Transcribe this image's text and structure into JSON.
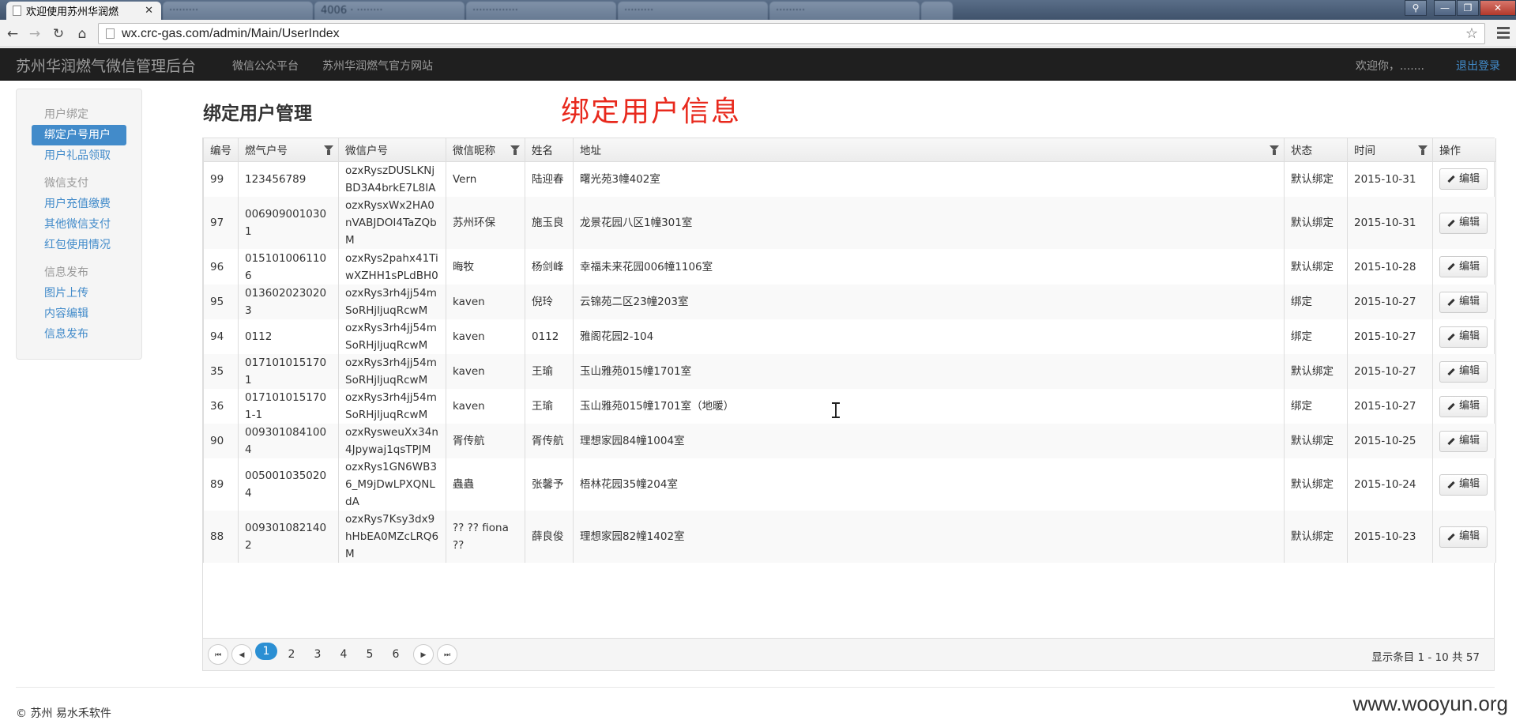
{
  "browser": {
    "active_tab_title": "欢迎使用苏州华润燃",
    "inactive_tabs": [
      "·········",
      "4006 · ········",
      "··············",
      "·········",
      "·········"
    ],
    "url": "wx.crc-gas.com/admin/Main/UserIndex"
  },
  "navbar": {
    "brand": "苏州华润燃气微信管理后台",
    "links": [
      "微信公众平台",
      "苏州华润燃气官方网站"
    ],
    "welcome": "欢迎你，.......",
    "logout": "退出登录"
  },
  "sidebar": {
    "groups": [
      {
        "header": "用户绑定",
        "items": [
          "绑定户号用户",
          "用户礼品领取"
        ]
      },
      {
        "header": "微信支付",
        "items": [
          "用户充值缴费",
          "其他微信支付",
          "红包使用情况"
        ]
      },
      {
        "header": "信息发布",
        "items": [
          "图片上传",
          "内容编辑",
          "信息发布"
        ]
      }
    ],
    "active_item": "绑定户号用户"
  },
  "main": {
    "title": "绑定用户管理",
    "annotation": "绑定用户信息"
  },
  "table": {
    "columns": [
      "编号",
      "燃气户号",
      "微信户号",
      "微信昵称",
      "姓名",
      "地址",
      "状态",
      "时间",
      "操作"
    ],
    "filter_columns": [
      "燃气户号",
      "微信昵称",
      "地址",
      "时间"
    ],
    "edit_label": "编辑",
    "rows": [
      [
        "99",
        "123456789",
        "ozxRyszDUSLKNjBD3A4brkE7L8IA",
        "Vern",
        "陆迎春",
        "曙光苑3幢402室",
        "默认绑定",
        "2015-10-31"
      ],
      [
        "97",
        "0069090010301",
        "ozxRysxWx2HA0nVABJDOI4TaZQbM",
        "苏州环保",
        "施玉良",
        "龙景花园八区1幢301室",
        "默认绑定",
        "2015-10-31"
      ],
      [
        "96",
        "0151010061106",
        "ozxRys2pahx41TiwXZHH1sPLdBH0",
        "晦牧",
        "杨剑峰",
        "幸福未来花园006幢1106室",
        "默认绑定",
        "2015-10-28"
      ],
      [
        "95",
        "0136020230203",
        "ozxRys3rh4jj54mSoRHjljuqRcwM",
        "kaven",
        "倪玲",
        "云锦苑二区23幢203室",
        "绑定",
        "2015-10-27"
      ],
      [
        "94",
        "0112",
        "ozxRys3rh4jj54mSoRHjljuqRcwM",
        "kaven",
        "0112",
        "雅阁花园2-104",
        "绑定",
        "2015-10-27"
      ],
      [
        "35",
        "0171010151701",
        "ozxRys3rh4jj54mSoRHjljuqRcwM",
        "kaven",
        "王瑜",
        "玉山雅苑015幢1701室",
        "默认绑定",
        "2015-10-27"
      ],
      [
        "36",
        "0171010151701-1",
        "ozxRys3rh4jj54mSoRHjljuqRcwM",
        "kaven",
        "王瑜",
        "玉山雅苑015幢1701室（地暖）",
        "绑定",
        "2015-10-27"
      ],
      [
        "90",
        "0093010841004",
        "ozxRysweuXx34n4Jpywaj1qsTPJM",
        "胥传航",
        "胥传航",
        "理想家园84幢1004室",
        "默认绑定",
        "2015-10-25"
      ],
      [
        "89",
        "0050010350204",
        "ozxRys1GN6WB36_M9jDwLPXQNLdA",
        "蟲蟲",
        "张馨予",
        "梧林花园35幢204室",
        "默认绑定",
        "2015-10-24"
      ],
      [
        "88",
        "0093010821402",
        "ozxRys7Ksy3dx9hHbEA0MZcLRQ6M",
        "?? ?? fiona ??",
        "薛良俊",
        "理想家园82幢1402室",
        "默认绑定",
        "2015-10-23"
      ]
    ]
  },
  "pager": {
    "pages": [
      "1",
      "2",
      "3",
      "4",
      "5",
      "6"
    ],
    "current": "1",
    "first_label": "⏮",
    "prev_label": "◀",
    "next_label": "▶",
    "last_label": "⏭",
    "info": "显示条目 1 - 10 共 57"
  },
  "footer": {
    "copyright": "© 苏州 易水禾软件",
    "watermark": "www.wooyun.org"
  }
}
